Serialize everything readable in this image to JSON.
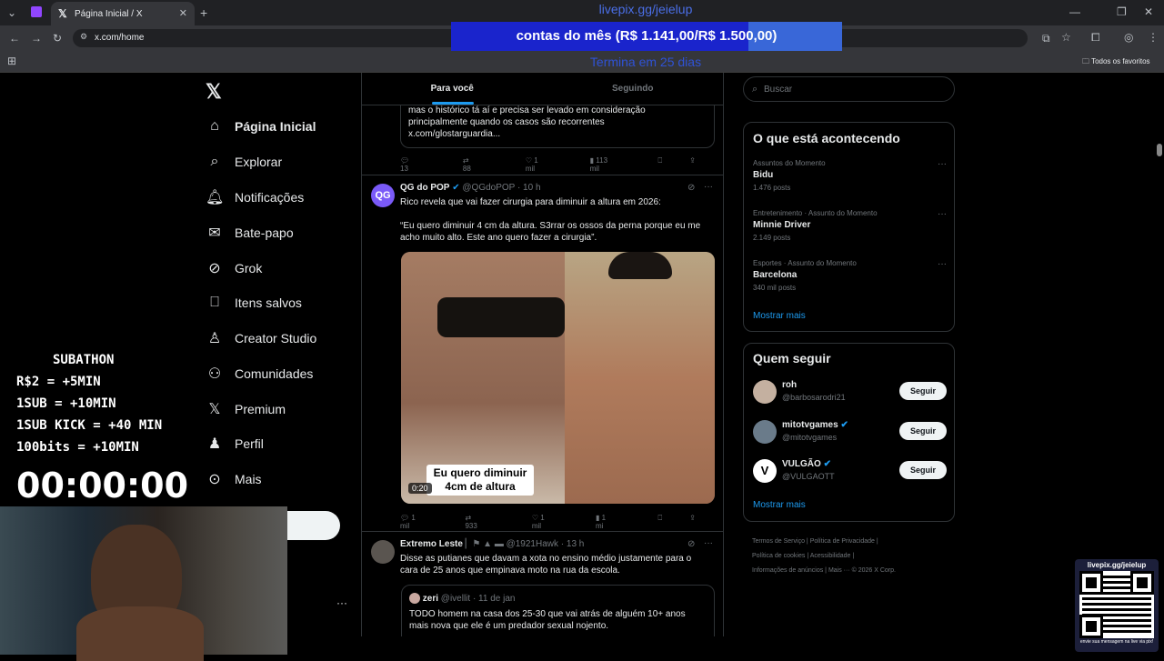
{
  "browser": {
    "tab_title": "Página Inicial / X",
    "url": "x.com/home",
    "bookmarks_folder": "Todos os favoritos"
  },
  "overlay": {
    "link": "livepix.gg/jeielup",
    "goal_text": "contas do mês (R$ 1.141,00/R$ 1.500,00)",
    "goal_progress": 0.76,
    "goal_sub": "Termina em 25 dias",
    "subathon": {
      "title": "SUBATHON",
      "line1": "R$2 = +5MIN",
      "line2": "1SUB = +10MIN",
      "line3": "1SUB KICK = +40 MIN",
      "line4": "100bits = +10MIN"
    },
    "timer": "00:00:00",
    "qr_title": "livepix.gg/jeielup",
    "qr_caption": "envie sua mensagem na live via pix!"
  },
  "nav": {
    "home": "Página Inicial",
    "explore": "Explorar",
    "notifications": "Notificações",
    "chat": "Bate-papo",
    "grok": "Grok",
    "saved": "Itens salvos",
    "creator": "Creator Studio",
    "communities": "Comunidades",
    "premium": "Premium",
    "profile": "Perfil",
    "more": "Mais"
  },
  "feed": {
    "tab_foryou": "Para você",
    "tab_following": "Seguindo",
    "prev_tweet": {
      "line1": "mas o histórico tá aí e precisa ser levado em consideração",
      "line2": "principalmente quando os casos são recorrentes",
      "line3": "x.com/glostarguardia...",
      "replies": "13",
      "retweets": "88",
      "likes": "1 mil",
      "views": "113 mil"
    },
    "tweet1": {
      "name": "QG do POP",
      "handle": "@QGdoPOP · 10 h",
      "text1": "Rico revela que vai fazer cirurgia para diminuir a altura em 2026:",
      "text2": "“Eu quero diminuir 4 cm da altura. S3rrar os ossos da perna porque eu me",
      "text3": "acho muito alto. Este ano quero fazer a cirurgia”.",
      "caption1": "Eu quero diminuir",
      "caption2": "4cm de altura",
      "duration": "0:20",
      "replies": "1 mil",
      "retweets": "933",
      "likes": "1 mil",
      "views": "1 mi"
    },
    "tweet2": {
      "name": "Extremo Leste",
      "handle": "@1921Hawk · 13 h",
      "text1": "Disse as putianes que davam a xota no ensino médio justamente para o",
      "text2": "cara de 25 anos que empinava moto na rua da escola.",
      "quote_name": "zeri",
      "quote_handle": "@ivellit · 11 de jan",
      "quote1": "TODO homem na casa dos 25-30 que vai atrás de alguém 10+ anos",
      "quote2": "mais nova que ele é um predador sexual nojento."
    }
  },
  "sidebar": {
    "search_placeholder": "Buscar",
    "trending_title": "O que está acontecendo",
    "trends": [
      {
        "context": "Assuntos do Momento",
        "name": "Bidu",
        "posts": "1.476 posts"
      },
      {
        "context": "Entretenimento · Assunto do Momento",
        "name": "Minnie Driver",
        "posts": "2.149 posts"
      },
      {
        "context": "Esportes · Assunto do Momento",
        "name": "Barcelona",
        "posts": "340 mil posts"
      }
    ],
    "show_more": "Mostrar mais",
    "who_title": "Quem seguir",
    "who": [
      {
        "name": "roh",
        "handle": "@barbosarodri21"
      },
      {
        "name": "mitotvgames",
        "handle": "@mitotvgames"
      },
      {
        "name": "VULGÃO",
        "handle": "@VULGAOTT"
      }
    ],
    "follow_label": "Seguir",
    "show_more2": "Mostrar mais",
    "footer": {
      "terms": "Termos de Serviço",
      "privacy": "Política de Privacidade",
      "cookies": "Política de cookies",
      "access": "Acessibilidade",
      "ads": "Informações de anúncios",
      "more": "Mais ···",
      "copy": "© 2026 X Corp."
    }
  }
}
